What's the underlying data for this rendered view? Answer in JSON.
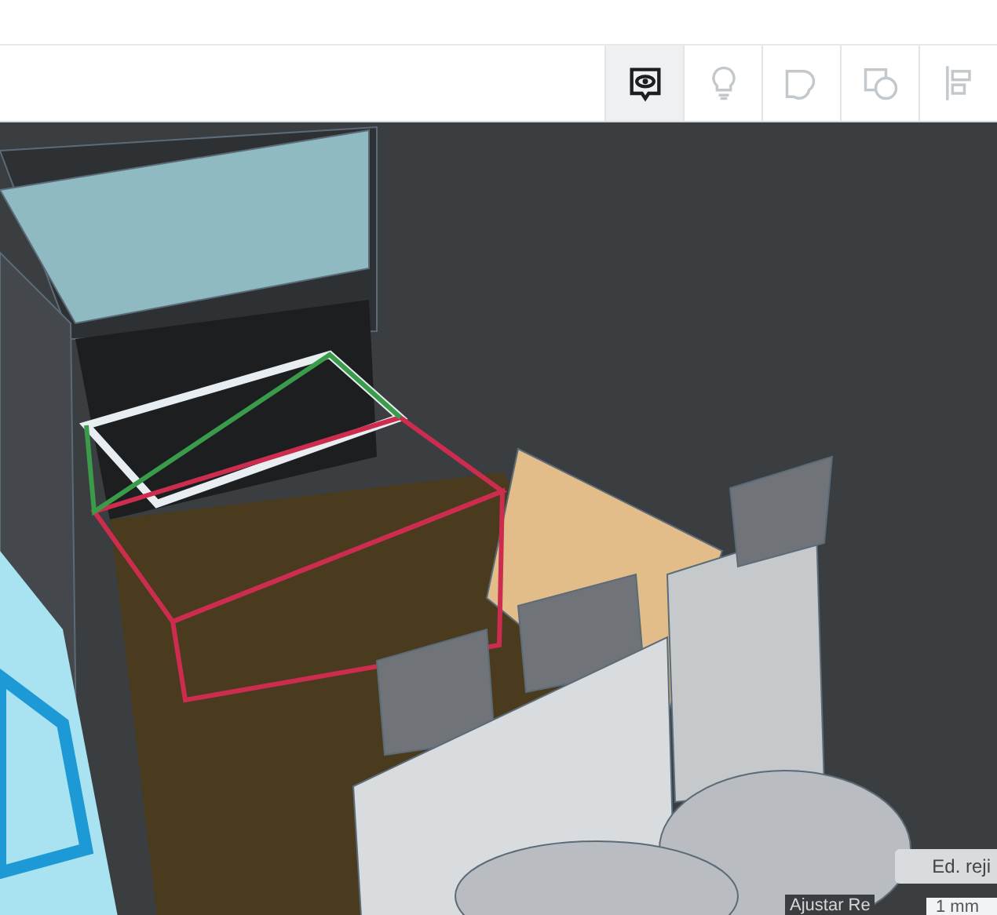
{
  "toolbar": {
    "tools": [
      {
        "kind": "note",
        "disabled": false
      },
      {
        "kind": "bulb",
        "disabled": true
      },
      {
        "kind": "shape",
        "disabled": true
      },
      {
        "kind": "group",
        "disabled": true
      },
      {
        "kind": "align",
        "disabled": true
      }
    ]
  },
  "grid_panel": {
    "edit_button": "Ed. reji",
    "snap_label": "Ajustar Re",
    "snap_value": "1 mm"
  }
}
